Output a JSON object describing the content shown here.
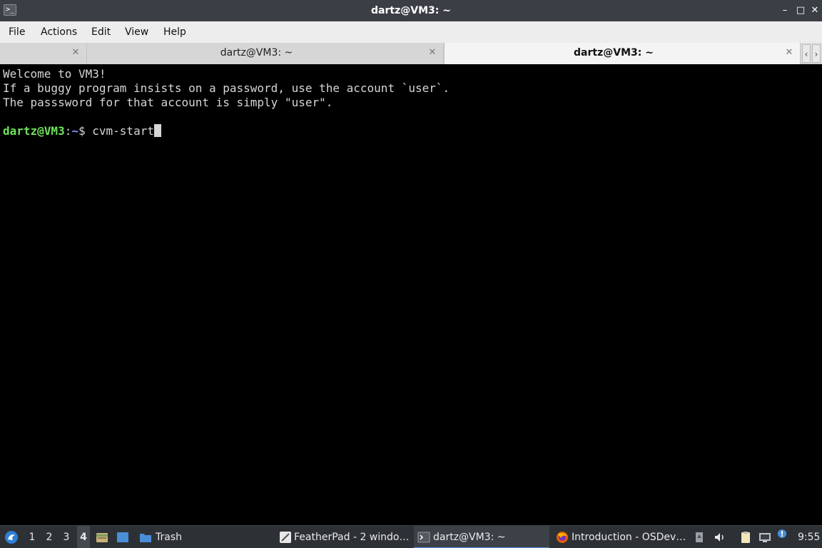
{
  "window": {
    "title": "dartz@VM3: ~",
    "app_icon_glyph": ">_",
    "controls": {
      "minimize": "–",
      "maximize": "□",
      "close": "✕"
    }
  },
  "menu": [
    "File",
    "Actions",
    "Edit",
    "View",
    "Help"
  ],
  "tabs": [
    {
      "label": "",
      "close": "✕",
      "active": false
    },
    {
      "label": "dartz@VM3: ~",
      "close": "✕",
      "active": false
    },
    {
      "label": "dartz@VM3: ~",
      "close": "✕",
      "active": true
    }
  ],
  "tab_scroll": {
    "left": "‹",
    "right": "›"
  },
  "terminal": {
    "lines": [
      "Welcome to VM3!",
      "If a buggy program insists on a password, use the account `user`.",
      "The passsword for that account is simply \"user\"."
    ],
    "prompt_user": "dartz@VM3",
    "prompt_sep": ":",
    "prompt_path": "~",
    "prompt_symbol": "$",
    "command": "cvm-start",
    "colors": {
      "background": "#000000",
      "text": "#d6d6d6",
      "user": "#6fe25a",
      "path": "#8a96ff"
    }
  },
  "taskbar": {
    "desktops": [
      "1",
      "2",
      "3",
      "4"
    ],
    "active_desktop": "4",
    "launchers": [
      "lxqt-menu-icon",
      "file-manager-icon",
      "show-desktop-icon"
    ],
    "trash_label": "Trash",
    "tasks": [
      {
        "label": "FeatherPad - 2 windo…",
        "icon": "featherpad-icon",
        "active": false
      },
      {
        "label": "dartz@VM3: ~",
        "icon": "terminal-icon",
        "active": true
      },
      {
        "label": "Introduction - OSDev…",
        "icon": "firefox-icon",
        "active": false
      }
    ],
    "tray": [
      "usb-icon",
      "volume-icon",
      "clipboard-icon",
      "network-icon",
      "update-notifier-icon"
    ],
    "clock": "9:55"
  }
}
